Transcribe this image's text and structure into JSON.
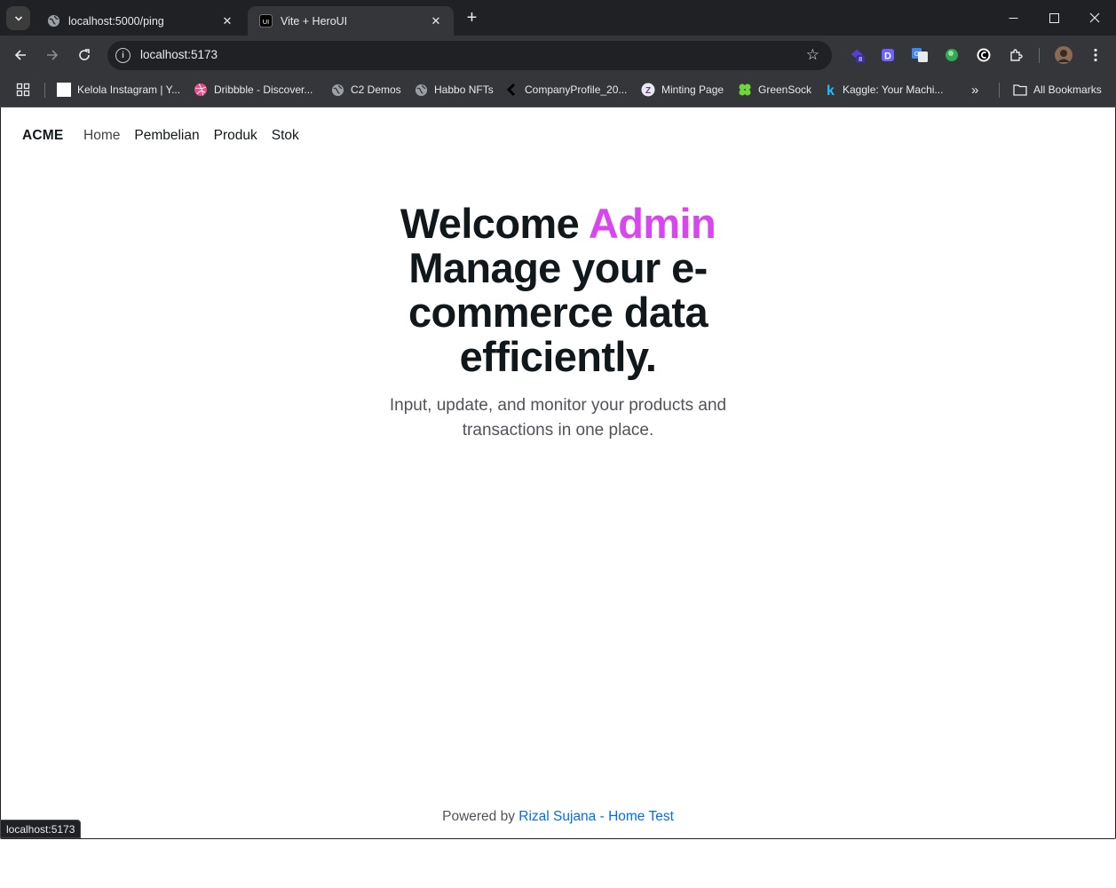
{
  "tabs": [
    {
      "title": "localhost:5000/ping",
      "active": false,
      "favicon": "globe-icon"
    },
    {
      "title": "Vite + HeroUI",
      "active": true,
      "favicon": "heroui-logo-icon"
    }
  ],
  "address_bar": {
    "url": "localhost:5173"
  },
  "bookmarks": [
    {
      "label": "Kelola Instagram | Y...",
      "icon": "white-square-icon"
    },
    {
      "label": "Dribbble - Discover...",
      "icon": "dribbble-icon"
    },
    {
      "label": "C2 Demos",
      "icon": "globe-icon"
    },
    {
      "label": "Habbo NFTs",
      "icon": "globe-icon"
    },
    {
      "label": "CompanyProfile_20...",
      "icon": "chevron-left-icon"
    },
    {
      "label": "Minting Page",
      "icon": "z-logo-icon"
    },
    {
      "label": "GreenSock",
      "icon": "greensock-icon"
    },
    {
      "label": "Kaggle: Your Machi...",
      "icon": "kaggle-icon"
    }
  ],
  "all_bookmarks_label": "All Bookmarks",
  "extension_badge": "8",
  "colors": {
    "accent": "#d946ef",
    "link": "#006fee",
    "chrome_dark": "#202124",
    "chrome_mid": "#35363a"
  },
  "app": {
    "brand": "ACME",
    "nav": [
      "Home",
      "Pembelian",
      "Produk",
      "Stok"
    ],
    "hero": {
      "welcome": "Welcome",
      "accent_word": "Admin",
      "headline": "Manage your e-commerce data efficiently.",
      "subtitle": "Input, update, and monitor your products and transactions in one place."
    },
    "footer": {
      "prefix": "Powered by",
      "link_text": "Rizal Sujana - Home Test"
    }
  },
  "status_url": "localhost:5173"
}
